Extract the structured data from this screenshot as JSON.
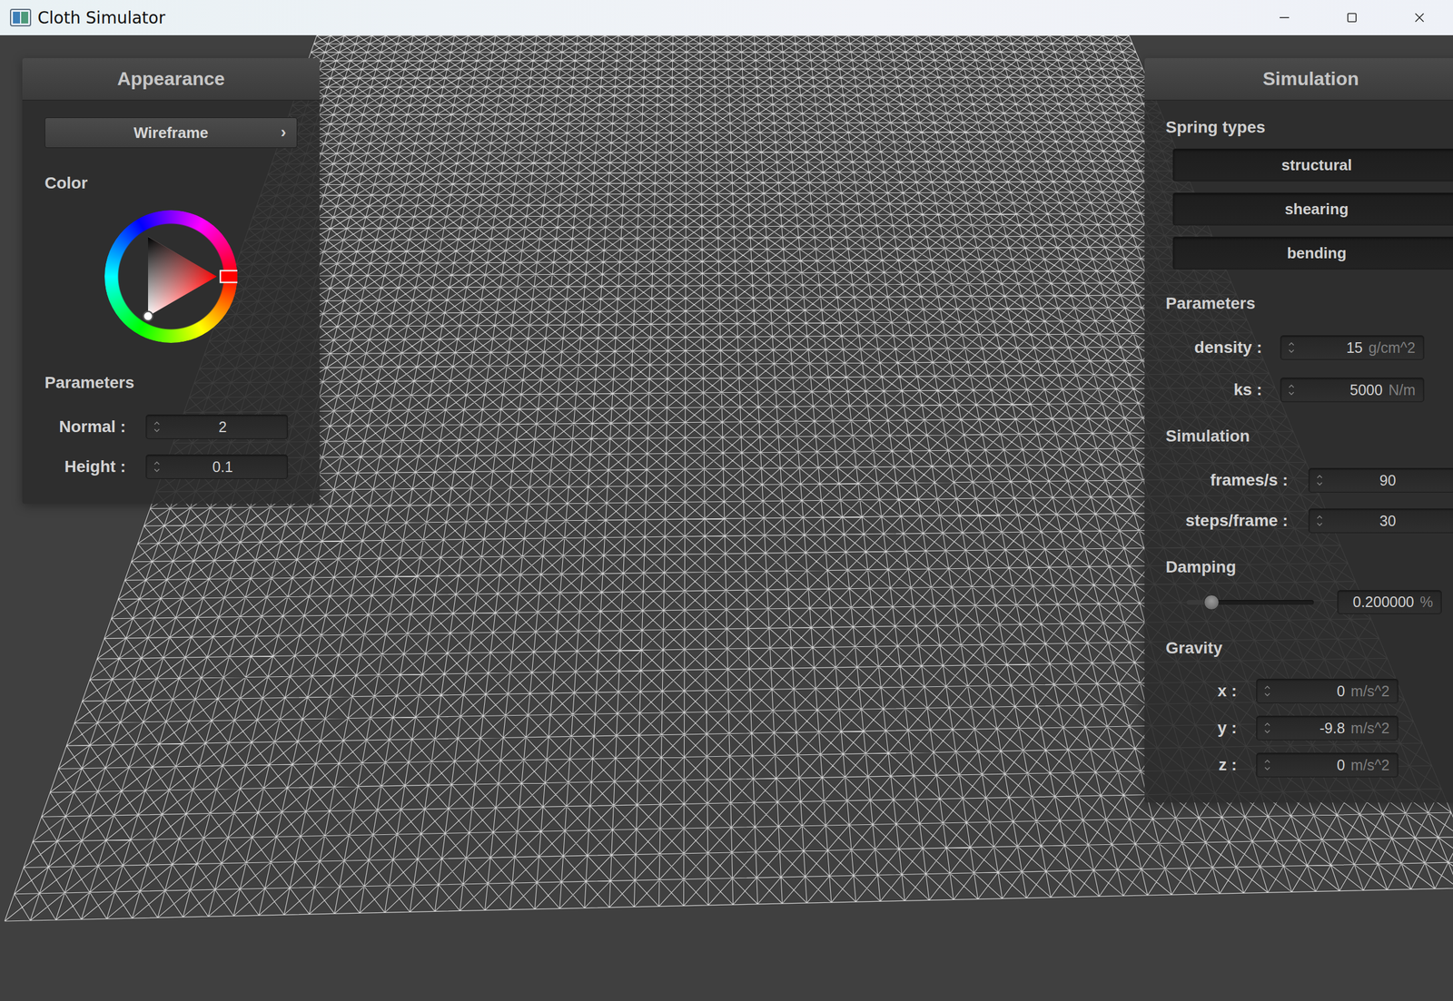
{
  "window": {
    "title": "Cloth Simulator"
  },
  "appearance": {
    "title": "Appearance",
    "shader": {
      "value": "Wireframe",
      "arrow": "›"
    },
    "color_label": "Color",
    "color_picker": {
      "hue_level": 0,
      "saturation": 0,
      "brightness": 1
    },
    "parameters_label": "Parameters",
    "fields": [
      {
        "label": "Normal :",
        "value": "2"
      },
      {
        "label": "Height :",
        "value": "0.1"
      }
    ]
  },
  "simulation": {
    "title": "Simulation",
    "spring_types_label": "Spring types",
    "spring_types": [
      {
        "label": "structural",
        "on": true
      },
      {
        "label": "shearing",
        "on": true
      },
      {
        "label": "bending",
        "on": true
      }
    ],
    "parameters_label": "Parameters",
    "parameters": [
      {
        "label": "density :",
        "value": "15",
        "unit": "g/cm^2"
      },
      {
        "label": "ks :",
        "value": "5000",
        "unit": "N/m"
      }
    ],
    "simulation_label": "Simulation",
    "simulation_fields": [
      {
        "label": "frames/s :",
        "value": "90"
      },
      {
        "label": "steps/frame :",
        "value": "30"
      }
    ],
    "damping": {
      "label": "Damping",
      "level": 0.2,
      "reading": "0.200000",
      "unit": "%"
    },
    "gravity": {
      "label": "Gravity",
      "fields": [
        {
          "label": "x :",
          "value": "0",
          "unit": "m/s^2"
        },
        {
          "label": "y :",
          "value": "-9.8",
          "unit": "m/s^2"
        },
        {
          "label": "z :",
          "value": "0",
          "unit": "m/s^2"
        }
      ]
    }
  }
}
